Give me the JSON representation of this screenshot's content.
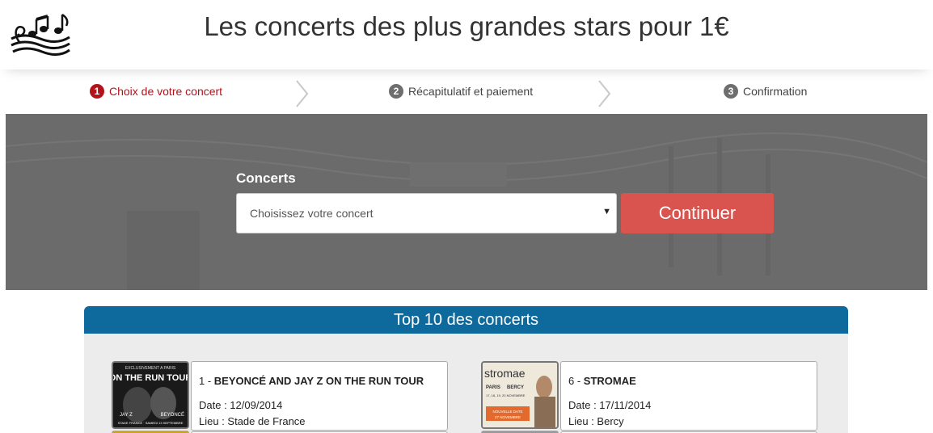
{
  "header": {
    "title": "Les concerts des plus grandes stars pour 1€",
    "logo_icon": "music-notes-logo"
  },
  "steps": [
    {
      "num": "1",
      "label": "Choix de votre concert",
      "active": true
    },
    {
      "num": "2",
      "label": "Récapitulatif et paiement",
      "active": false
    },
    {
      "num": "3",
      "label": "Confirmation",
      "active": false
    }
  ],
  "search": {
    "label": "Concerts",
    "select_value": "Choisissez votre concert",
    "button_label": "Continuer"
  },
  "top10": {
    "title": "Top 10 des concerts",
    "items": [
      {
        "rank": "1",
        "sep": " - ",
        "name": "BEYONCÉ AND JAY Z ON THE RUN TOUR",
        "date": "Date : 12/09/2014",
        "place": "Lieu : Stade de France",
        "poster": {
          "top": "EXCLUSIVEMENT A PARIS",
          "main": "ON THE RUN TOUR",
          "side": "BEYONCÉ",
          "bottom": "STADE FRANCE · SAMEDI 13 SEPTEMBRE",
          "left": "JAY Z"
        }
      },
      {
        "rank": "6",
        "sep": " - ",
        "name": "STROMAE",
        "date": "Date : 17/11/2014",
        "place": "Lieu : Bercy",
        "poster": {
          "main": "stromae",
          "line1": "PARIS",
          "line2": "BERCY",
          "line3": "17, 18, 19, 20 NOVEMBRE",
          "badge": "NOUVELLE DATE",
          "badge2": "27 NOVEMBRE"
        }
      }
    ]
  },
  "colors": {
    "accent": "#b3121a",
    "banner": "#6b6b6b",
    "button": "#d9534f",
    "panel_header": "#0e6a9c"
  }
}
